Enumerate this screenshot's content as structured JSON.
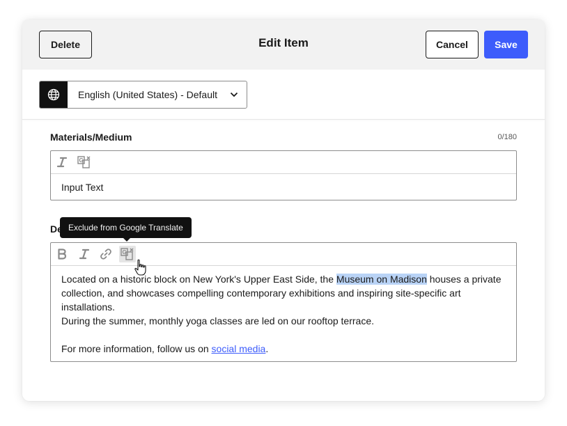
{
  "header": {
    "title": "Edit Item",
    "delete_label": "Delete",
    "cancel_label": "Cancel",
    "save_label": "Save"
  },
  "language": {
    "icon": "globe-icon",
    "selected": "English (United States) - Default"
  },
  "materials": {
    "label": "Materials/Medium",
    "counter": "0/180",
    "toolbar_icons": [
      "italic-icon",
      "exclude-translate-icon"
    ],
    "value": "Input Text"
  },
  "description": {
    "label": "De",
    "toolbar_icons": [
      "bold-icon",
      "italic-icon",
      "link-icon",
      "exclude-translate-icon"
    ],
    "line1_before": "Located on a historic block on New York's Upper East Side, the ",
    "line1_highlight": "Museum on Madison",
    "line1_after": " houses a private collection, and showcases compelling contemporary exhibitions and inspiring site-specific art installations.",
    "line2": "During the summer, monthly yoga classes are led on our rooftop terrace.",
    "line3_before": "For more information, follow us on ",
    "line3_link": "social media",
    "line3_after": "."
  },
  "tooltip": {
    "text": "Exclude from Google Translate"
  },
  "colors": {
    "accent": "#3d5cfb",
    "header_bg": "#f2f2f2",
    "highlight": "#b9d3f6",
    "tooltip_bg": "#111111"
  }
}
